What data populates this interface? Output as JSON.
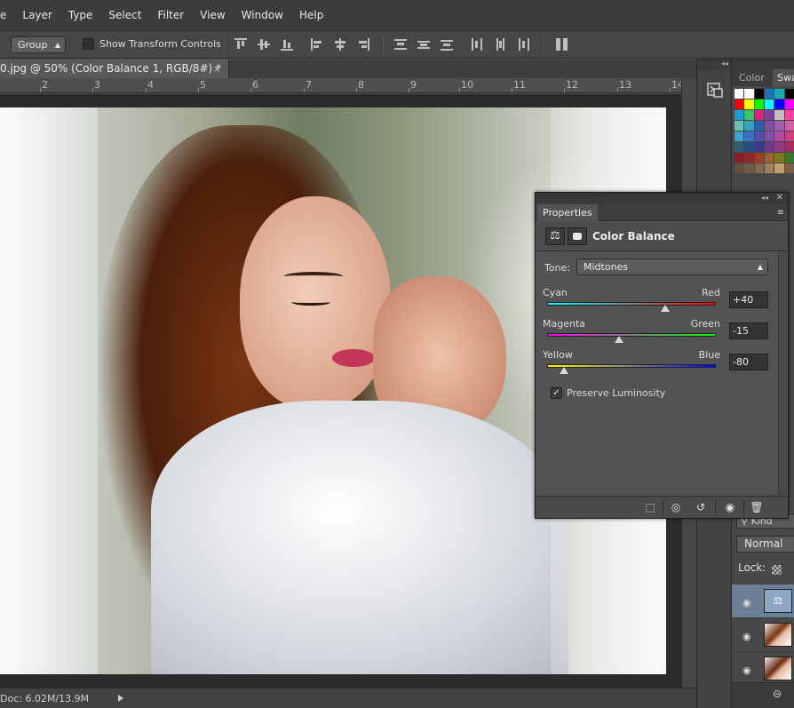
{
  "menubar": {
    "items": [
      "e",
      "Layer",
      "Type",
      "Select",
      "Filter",
      "View",
      "Window",
      "Help"
    ]
  },
  "options": {
    "group_select": "Group",
    "show_transform_label": "Show Transform Controls"
  },
  "document": {
    "tab_title": "0.jpg @ 50% (Color Balance 1, RGB/8#) *",
    "close_glyph": "×"
  },
  "ruler": {
    "numbers": [
      "2",
      "3",
      "4",
      "5",
      "6",
      "7",
      "8",
      "9",
      "10",
      "11",
      "12",
      "13",
      "14"
    ]
  },
  "status": {
    "doc_info": "Doc: 6.02M/13.9M"
  },
  "right_panel": {
    "tabs": [
      "Color",
      "Swa"
    ],
    "kind_label": "Kind",
    "blend_mode": "Normal",
    "lock_label": "Lock:",
    "swatch_rows": [
      [
        "#ffffff",
        "#ffffff",
        "#000000",
        "#1e74b8",
        "#1ca8b0",
        "#000000"
      ],
      [
        "#ff0000",
        "#ffff00",
        "#00ff00",
        "#00ffff",
        "#0000ff",
        "#ff00ff"
      ],
      [
        "#1aa0d8",
        "#3dc06b",
        "#e0207c",
        "#8040a0",
        "#c0c0c0",
        "#ff40a0"
      ],
      [
        "#70c0b0",
        "#3aa0c0",
        "#2a60b0",
        "#8050a0",
        "#a060b0",
        "#d060a0"
      ],
      [
        "#40a0d0",
        "#4070c0",
        "#5050b0",
        "#8050b0",
        "#b04ca0",
        "#d04080"
      ],
      [
        "#306070",
        "#284c80",
        "#3a3a90",
        "#6a3a90",
        "#903a80",
        "#a03060"
      ],
      [
        "#8a1a2a",
        "#8a2a2a",
        "#a04020",
        "#a06030",
        "#7a7a20",
        "#3a7a30"
      ],
      [
        "#605040",
        "#705a4a",
        "#806a50",
        "#a08060",
        "#c0a070",
        "#7a6048"
      ]
    ]
  },
  "properties": {
    "tab_label": "Properties",
    "header_title": "Color Balance",
    "tone_label": "Tone:",
    "tone_value": "Midtones",
    "sliders": [
      {
        "left": "Cyan",
        "right": "Red",
        "value": "+40",
        "fraction": 0.7
      },
      {
        "left": "Magenta",
        "right": "Green",
        "value": "-15",
        "fraction": 0.425
      },
      {
        "left": "Yellow",
        "right": "Blue",
        "value": "-80",
        "fraction": 0.1
      }
    ],
    "preserve_label": "Preserve Luminosity",
    "preserve_checked": "✓"
  },
  "icons": {
    "balance": "⚖",
    "eye": "👁",
    "menu": "≡",
    "collapse": "◂◂",
    "close": "✕"
  }
}
